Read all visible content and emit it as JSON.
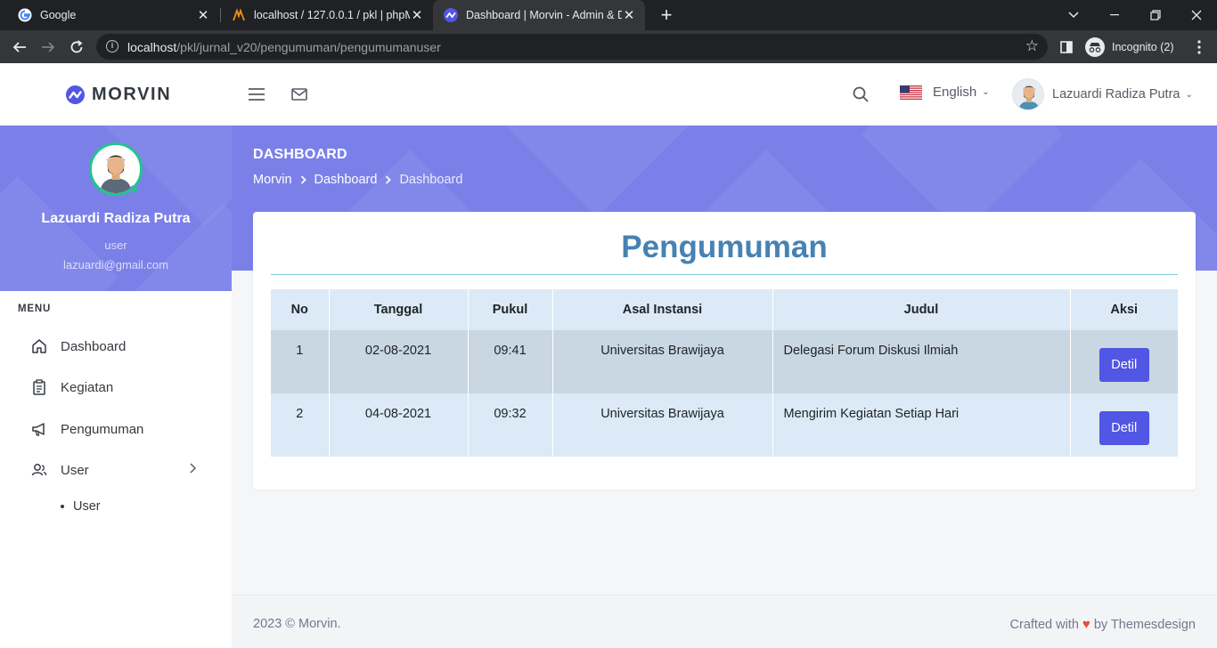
{
  "browser": {
    "tabs": [
      {
        "title": "Google",
        "icon": "google-icon"
      },
      {
        "title": "localhost / 127.0.0.1 / pkl | phpM",
        "icon": "phpmyadmin-icon"
      },
      {
        "title": "Dashboard | Morvin - Admin & D",
        "icon": "morvin-icon"
      }
    ],
    "url_host": "localhost",
    "url_path": "/pkl/jurnal_v20/pengumuman/pengumumanuser",
    "incognito_label": "Incognito (2)"
  },
  "header": {
    "brand": "MORVIN",
    "language": "English",
    "user_name": "Lazuardi Radiza Putra"
  },
  "sidebar": {
    "profile": {
      "name": "Lazuardi Radiza Putra",
      "role": "user",
      "email": "lazuardi@gmail.com"
    },
    "menu_title": "MENU",
    "items": [
      {
        "label": "Dashboard"
      },
      {
        "label": "Kegiatan"
      },
      {
        "label": "Pengumuman"
      },
      {
        "label": "User"
      }
    ],
    "subitems": [
      {
        "label": "User"
      }
    ]
  },
  "page": {
    "title": "DASHBOARD",
    "breadcrumb": [
      "Morvin",
      "Dashboard",
      "Dashboard"
    ]
  },
  "card": {
    "title": "Pengumuman",
    "columns": [
      "No",
      "Tanggal",
      "Pukul",
      "Asal Instansi",
      "Judul",
      "Aksi"
    ],
    "rows": [
      {
        "no": "1",
        "tanggal": "02-08-2021",
        "pukul": "09:41",
        "instansi": "Universitas Brawijaya",
        "judul": "Delegasi Forum Diskusi Ilmiah",
        "aksi": "Detil"
      },
      {
        "no": "2",
        "tanggal": "04-08-2021",
        "pukul": "09:32",
        "instansi": "Universitas Brawijaya",
        "judul": "Mengirim Kegiatan Setiap Hari",
        "aksi": "Detil"
      }
    ]
  },
  "footer": {
    "left": "2023 © Morvin.",
    "right_prefix": "Crafted with",
    "right_suffix": "by Themesdesign"
  },
  "colors": {
    "accent": "#7b80e9",
    "button": "#5156e4",
    "title": "#4682b4"
  }
}
